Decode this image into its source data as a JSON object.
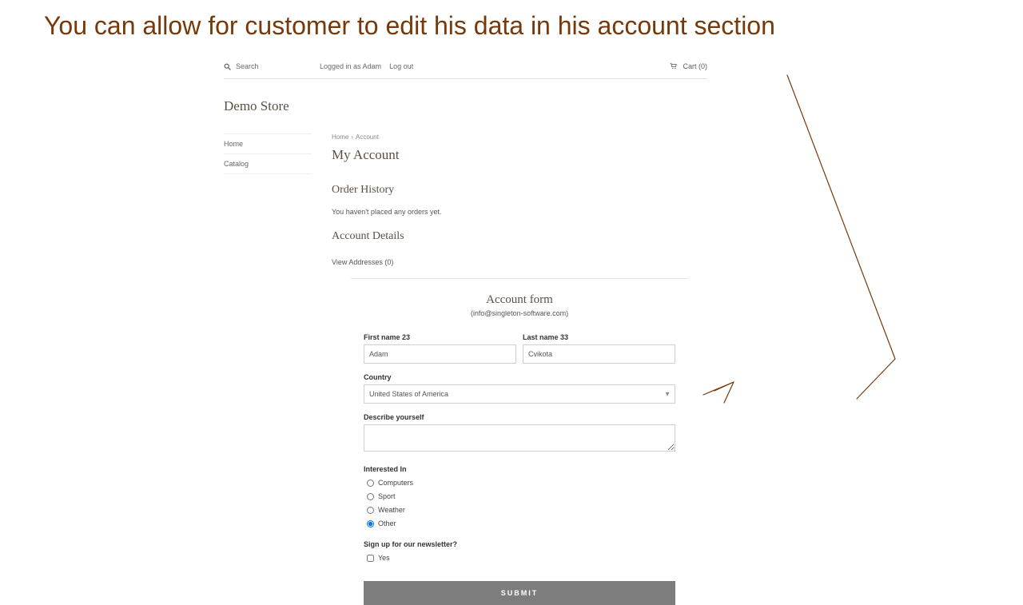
{
  "banner": "You can allow for customer to edit his data in his account section",
  "topbar": {
    "search_placeholder": "Search",
    "logged_in_label": "Logged in as Adam",
    "logout_label": "Log out",
    "cart_label": "Cart (0)"
  },
  "brand": "Demo Store",
  "sidebar": {
    "items": [
      {
        "label": "Home"
      },
      {
        "label": "Catalog"
      }
    ]
  },
  "breadcrumbs": {
    "home": "Home",
    "account": "Account"
  },
  "page": {
    "title": "My Account",
    "order_history_heading": "Order History",
    "order_history_empty": "You haven't placed any orders yet.",
    "account_details_heading": "Account Details",
    "view_addresses": "View Addresses (0)"
  },
  "form": {
    "title": "Account form",
    "subtitle": "(info@singleton-software.com)",
    "first_name_label": "First name 23",
    "first_name_value": "Adam",
    "last_name_label": "Last name 33",
    "last_name_value": "Cvikota",
    "country_label": "Country",
    "country_value": "United States of America",
    "describe_label": "Describe yourself",
    "describe_value": "",
    "interested_label": "Interested In",
    "interest_options": [
      "Computers",
      "Sport",
      "Weather",
      "Other"
    ],
    "interest_selected": "Other",
    "newsletter_label": "Sign up for our newsletter?",
    "newsletter_option": "Yes",
    "submit_label": "SUBMIT"
  }
}
